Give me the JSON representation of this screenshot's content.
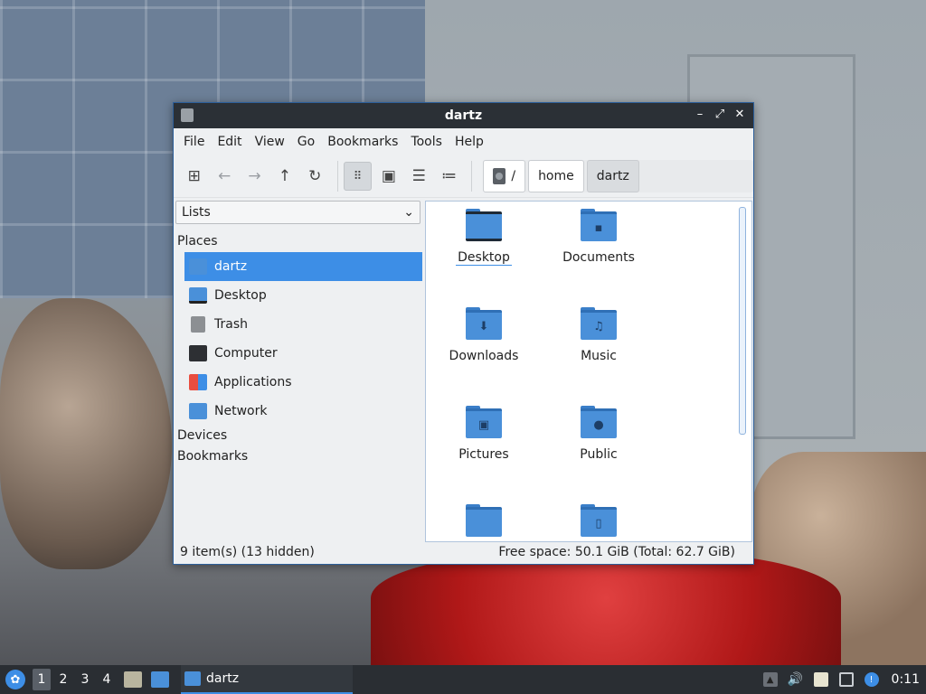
{
  "window": {
    "title": "dartz",
    "controls": {
      "minimize": "–",
      "maximize": "⤢",
      "close": "✕"
    }
  },
  "menubar": [
    "File",
    "Edit",
    "View",
    "Go",
    "Bookmarks",
    "Tools",
    "Help"
  ],
  "toolbar": {
    "buttons": [
      {
        "name": "new-window",
        "icon": "new-window-icon"
      },
      {
        "name": "back",
        "icon": "arrow-left-icon"
      },
      {
        "name": "forward",
        "icon": "arrow-right-icon"
      },
      {
        "name": "up",
        "icon": "arrow-up-icon"
      },
      {
        "name": "reload",
        "icon": "reload-icon"
      },
      {
        "name": "icon-view",
        "icon": "grid-view-icon",
        "active": true
      },
      {
        "name": "thumbnail-view",
        "icon": "image-view-icon"
      },
      {
        "name": "compact-view",
        "icon": "compact-list-icon"
      },
      {
        "name": "detailed-view",
        "icon": "detailed-list-icon"
      }
    ],
    "path": [
      "/",
      "home",
      "dartz"
    ]
  },
  "sidebar": {
    "mode": "Lists",
    "sections": {
      "places": "Places",
      "devices": "Devices",
      "bookmarks": "Bookmarks"
    },
    "places": [
      {
        "label": "dartz",
        "icon": "home-folder-icon",
        "selected": true
      },
      {
        "label": "Desktop",
        "icon": "desktop-icon"
      },
      {
        "label": "Trash",
        "icon": "trash-icon"
      },
      {
        "label": "Computer",
        "icon": "computer-icon"
      },
      {
        "label": "Applications",
        "icon": "applications-icon"
      },
      {
        "label": "Network",
        "icon": "network-icon"
      }
    ]
  },
  "files": [
    {
      "label": "Desktop",
      "icon": "desktop-folder-icon",
      "glyph": ""
    },
    {
      "label": "Documents",
      "icon": "documents-folder-icon",
      "glyph": "▪"
    },
    {
      "label": "Downloads",
      "icon": "downloads-folder-icon",
      "glyph": "⬇"
    },
    {
      "label": "Music",
      "icon": "music-folder-icon",
      "glyph": "♫"
    },
    {
      "label": "Pictures",
      "icon": "pictures-folder-icon",
      "glyph": "▣"
    },
    {
      "label": "Public",
      "icon": "public-folder-icon",
      "glyph": "●"
    },
    {
      "label": "",
      "icon": "folder-icon",
      "glyph": ""
    },
    {
      "label": "",
      "icon": "templates-folder-icon",
      "glyph": "▯"
    }
  ],
  "status": {
    "items": "9 item(s) (13 hidden)",
    "free_space": "Free space: 50.1 GiB (Total: 62.7 GiB)"
  },
  "taskbar": {
    "workspaces": [
      "1",
      "2",
      "3",
      "4"
    ],
    "active_workspace": "1",
    "task_title": "dartz",
    "clock": "0:11"
  },
  "colors": {
    "accent": "#3d8ee6",
    "folder": "#4a90d9",
    "titlebar": "#2b3036",
    "taskbar": "#2a2e33"
  }
}
